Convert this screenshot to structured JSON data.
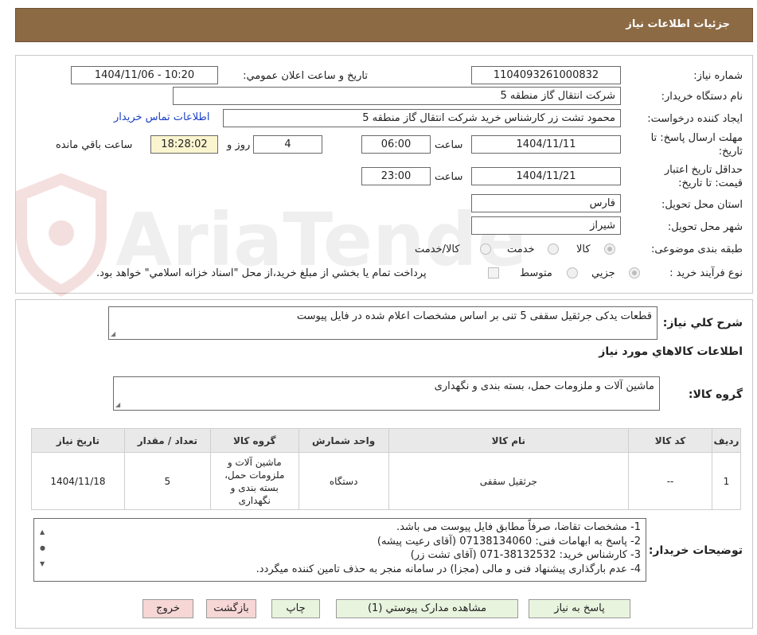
{
  "header": {
    "title": "جزئیات اطلاعات نیاز"
  },
  "details": {
    "need_number_label": "شماره نیاز:",
    "need_number": "1104093261000832",
    "announce_label": "تاریخ و ساعت اعلان عمومي:",
    "announce_value": "1404/11/06 - 10:20",
    "buyer_org_label": "نام دستگاه خريدار:",
    "buyer_org": "شرکت انتقال گاز منطقه 5",
    "creator_label": "ايجاد کننده درخواست:",
    "creator": "محمود تشت زر کارشناس خرید شرکت انتقال گاز منطقه 5",
    "contact_link": "اطلاعات تماس خريدار",
    "reply_deadline_label_1": "مهلت ارسال پاسخ: تا",
    "reply_deadline_label_2": "تاريخ:",
    "reply_date": "1404/11/11",
    "time_label": "ساعت",
    "reply_time": "06:00",
    "days_value": "4",
    "days_label": "روز و",
    "remaining_time": "18:28:02",
    "remaining_label": "ساعت باقي مانده",
    "validity_label_1": "حداقل تاريخ اعتبار",
    "validity_label_2": "قيمت: تا تاريخ:",
    "validity_date": "1404/11/21",
    "validity_time": "23:00",
    "province_label": "استان محل تحويل:",
    "province": "فارس",
    "city_label": "شهر محل تحويل:",
    "city": "شیراز",
    "category_label": "طبقه بندی موضوعی:",
    "category_options": [
      "کالا",
      "خدمت",
      "کالا/خدمت"
    ],
    "category_selected": "کالا",
    "process_label": "نوع فرآیند خرید :",
    "process_options": [
      "جزيي",
      "متوسط"
    ],
    "process_selected": "جزيي",
    "process_note": "پرداخت تمام يا بخشي از مبلغ خريد،از محل \"اسناد خزانه اسلامي\" خواهد بود."
  },
  "summary": {
    "label": "شرح کلي نياز:",
    "value": "قطعات يدکی جرثقيل سقفی 5 تنی بر اساس مشخصات اعلام شده در فايل پيوست",
    "goods_section_title": "اطلاعات کالاهاي مورد نياز",
    "goods_group_label": "گروه کالا:",
    "goods_group_value": "ماشين آلات و ملزومات حمل، بسته بندی و نگهداری"
  },
  "table": {
    "headers": [
      "رديف",
      "کد کالا",
      "نام کالا",
      "واحد شمارش",
      "گروه کالا",
      "تعداد / مقدار",
      "تاريخ نياز"
    ],
    "rows": [
      {
        "row": "1",
        "code": "--",
        "name": "جرثقيل سقفی",
        "unit": "دستگاه",
        "group": "ماشين آلات و ملزومات حمل، بسته بندی و نگهداری",
        "qty": "5",
        "date": "1404/11/18"
      }
    ]
  },
  "notes": {
    "label": "توضيحات خريدار:",
    "lines": [
      "1-  مشخصات تقاضا، صرفاً مطابق فايل پيوست می باشد.",
      "2- پاسخ به ابهامات فنی: 07138134060 (آقای رعيت پيشه)",
      "3- کارشناس خريد: 38132532-071 (آقای تشت زر)",
      "4- عدم بارگذاری پيشنهاد فنی و مالی (مجزا) در سامانه منجر به حذف تامين کننده ميگردد."
    ]
  },
  "buttons": {
    "reply": "پاسخ به نياز",
    "docs": "مشاهده مدارک پيوستي (1)",
    "print": "چاپ",
    "back": "بازگشت",
    "exit": "خروج"
  },
  "watermark": {
    "text": "AriaTender.neT"
  },
  "colors": {
    "title_bar": "#8c6a44",
    "link": "#1a3fc4",
    "yellow_box": "#fbf5cf",
    "green_button": "#e9f4df",
    "pink_button": "#f7d6d6"
  }
}
